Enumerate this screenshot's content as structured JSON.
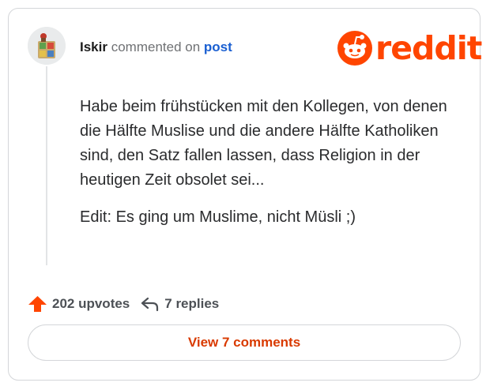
{
  "comment": {
    "username": "Iskir",
    "action_text": "commented on",
    "post_link": "post",
    "body_paragraph": "Habe beim frühstücken mit den Kollegen, von denen die Hälfte Muslise und die andere Hälfte Katholiken sind, den Satz fallen lassen, dass Religion in der heutigen Zeit obsolet sei...",
    "edit_paragraph": "Edit: Es ging um Muslime, nicht Müsli ;)"
  },
  "brand": {
    "logo_text": "reddit",
    "color": "#ff4500"
  },
  "footer": {
    "upvotes_label": "202 upvotes",
    "replies_label": "7 replies",
    "view_comments_label": "View 7 comments"
  },
  "icons": {
    "avatar": "avatar-image",
    "logo": "reddit-snoo-icon",
    "upvote": "upvote-arrow-icon",
    "reply": "reply-arrow-icon"
  }
}
